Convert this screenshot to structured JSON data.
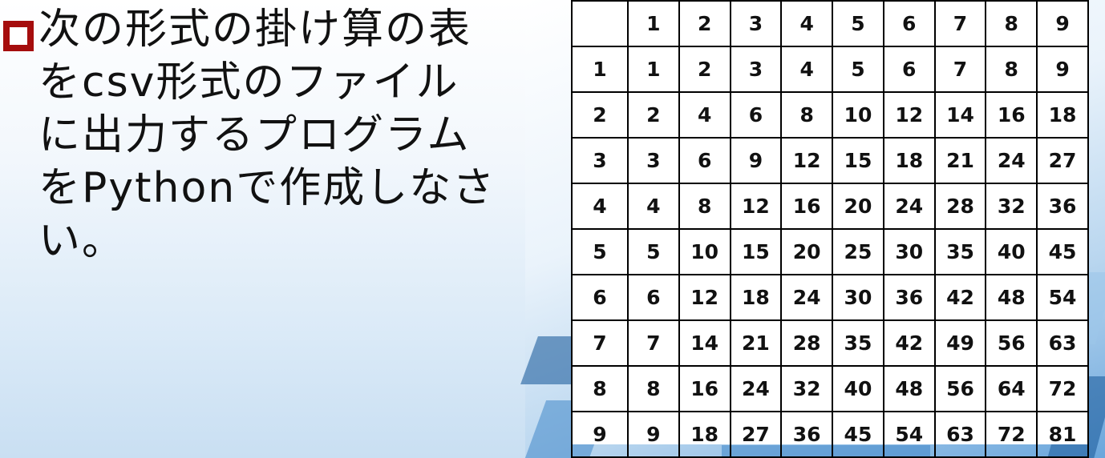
{
  "slide": {
    "bullet_text": "次の形式の掛け算の表\nをcsv形式のファイル\nに出力するプログラム\nをPythonで作成しなさ\nい。",
    "accent_color": "#a50d0d",
    "bullet_icon": "hollow-square-bullet-icon"
  },
  "table": {
    "header": [
      "",
      "1",
      "2",
      "3",
      "4",
      "5",
      "6",
      "7",
      "8",
      "9"
    ],
    "rows": [
      [
        "1",
        "1",
        "2",
        "3",
        "4",
        "5",
        "6",
        "7",
        "8",
        "9"
      ],
      [
        "2",
        "2",
        "4",
        "6",
        "8",
        "10",
        "12",
        "14",
        "16",
        "18"
      ],
      [
        "3",
        "3",
        "6",
        "9",
        "12",
        "15",
        "18",
        "21",
        "24",
        "27"
      ],
      [
        "4",
        "4",
        "8",
        "12",
        "16",
        "20",
        "24",
        "28",
        "32",
        "36"
      ],
      [
        "5",
        "5",
        "10",
        "15",
        "20",
        "25",
        "30",
        "35",
        "40",
        "45"
      ],
      [
        "6",
        "6",
        "12",
        "18",
        "24",
        "30",
        "36",
        "42",
        "48",
        "54"
      ],
      [
        "7",
        "7",
        "14",
        "21",
        "28",
        "35",
        "42",
        "49",
        "56",
        "63"
      ],
      [
        "8",
        "8",
        "16",
        "24",
        "32",
        "40",
        "48",
        "56",
        "64",
        "72"
      ],
      [
        "9",
        "9",
        "18",
        "27",
        "36",
        "45",
        "54",
        "63",
        "72",
        "81"
      ]
    ]
  }
}
